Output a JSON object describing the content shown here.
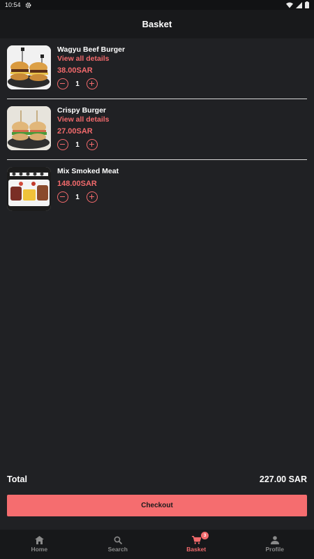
{
  "status_bar": {
    "time": "10:54"
  },
  "header": {
    "title": "Basket"
  },
  "items": [
    {
      "name": "Wagyu Beef Burger",
      "details_link": "View all details",
      "price": "38.00SAR",
      "quantity": "1"
    },
    {
      "name": "Crispy Burger",
      "details_link": "View all details",
      "price": "27.00SAR",
      "quantity": "1"
    },
    {
      "name": "Mix Smoked Meat",
      "price": "148.00SAR",
      "quantity": "1"
    }
  ],
  "summary": {
    "total_label": "Total",
    "total_value": "227.00 SAR"
  },
  "checkout": {
    "label": "Checkout"
  },
  "nav": {
    "items": [
      {
        "label": "Home",
        "icon": "home-icon"
      },
      {
        "label": "Search",
        "icon": "search-icon"
      },
      {
        "label": "Basket",
        "icon": "cart-icon",
        "badge": "3"
      },
      {
        "label": "Profile",
        "icon": "person-icon"
      }
    ]
  },
  "colors": {
    "accent": "#f26a6c",
    "background": "#202124",
    "header": "#18191b"
  }
}
